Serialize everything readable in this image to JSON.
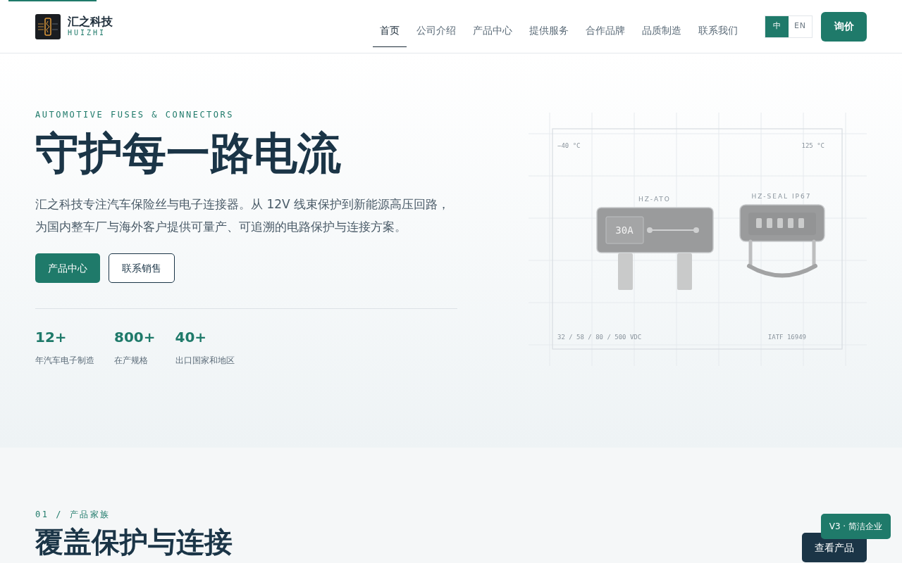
{
  "brand": {
    "name": "汇之科技",
    "subtitle": "HUIZHI"
  },
  "nav": [
    {
      "label": "首页",
      "selected": true
    },
    {
      "label": "公司介绍",
      "selected": false
    },
    {
      "label": "产品中心",
      "selected": false
    },
    {
      "label": "提供服务",
      "selected": false
    },
    {
      "label": "合作品牌",
      "selected": false
    },
    {
      "label": "品质制造",
      "selected": false
    },
    {
      "label": "联系我们",
      "selected": false
    }
  ],
  "languages": [
    {
      "label": "中",
      "selected": true
    },
    {
      "label": "EN",
      "selected": false
    }
  ],
  "inquiry_button": "询价",
  "hero": {
    "eyebrow": "AUTOMOTIVE FUSES & CONNECTORS",
    "title": "守护每一路电流",
    "description": "汇之科技专注汽车保险丝与电子连接器。从 12V 线束保护到新能源高压回路，为国内整车厂与海外客户提供可量产、可追溯的电路保护与连接方案。",
    "buttons": [
      {
        "label": "产品中心",
        "kind": "primary"
      },
      {
        "label": "联系销售",
        "kind": "outline"
      }
    ],
    "stats": [
      {
        "value": "12+",
        "label": "年汽车电子制造"
      },
      {
        "value": "800+",
        "label": "在产规格"
      },
      {
        "value": "40+",
        "label": "出口国家和地区"
      }
    ],
    "diagram": {
      "temp_low": "−40 °C",
      "temp_high": "125 °C",
      "fuse_label": "HZ-ATO",
      "fuse_rating": "30A",
      "connector_label": "HZ-SEAL IP67",
      "voltages": "32 / 58 / 80 / 500 VDC",
      "certification": "IATF 16949"
    }
  },
  "section": {
    "eyebrow": "01 / 产品家族",
    "title": "覆盖保护与连接",
    "button": "查看产品"
  },
  "version_badge": "V3 · 简洁企业"
}
